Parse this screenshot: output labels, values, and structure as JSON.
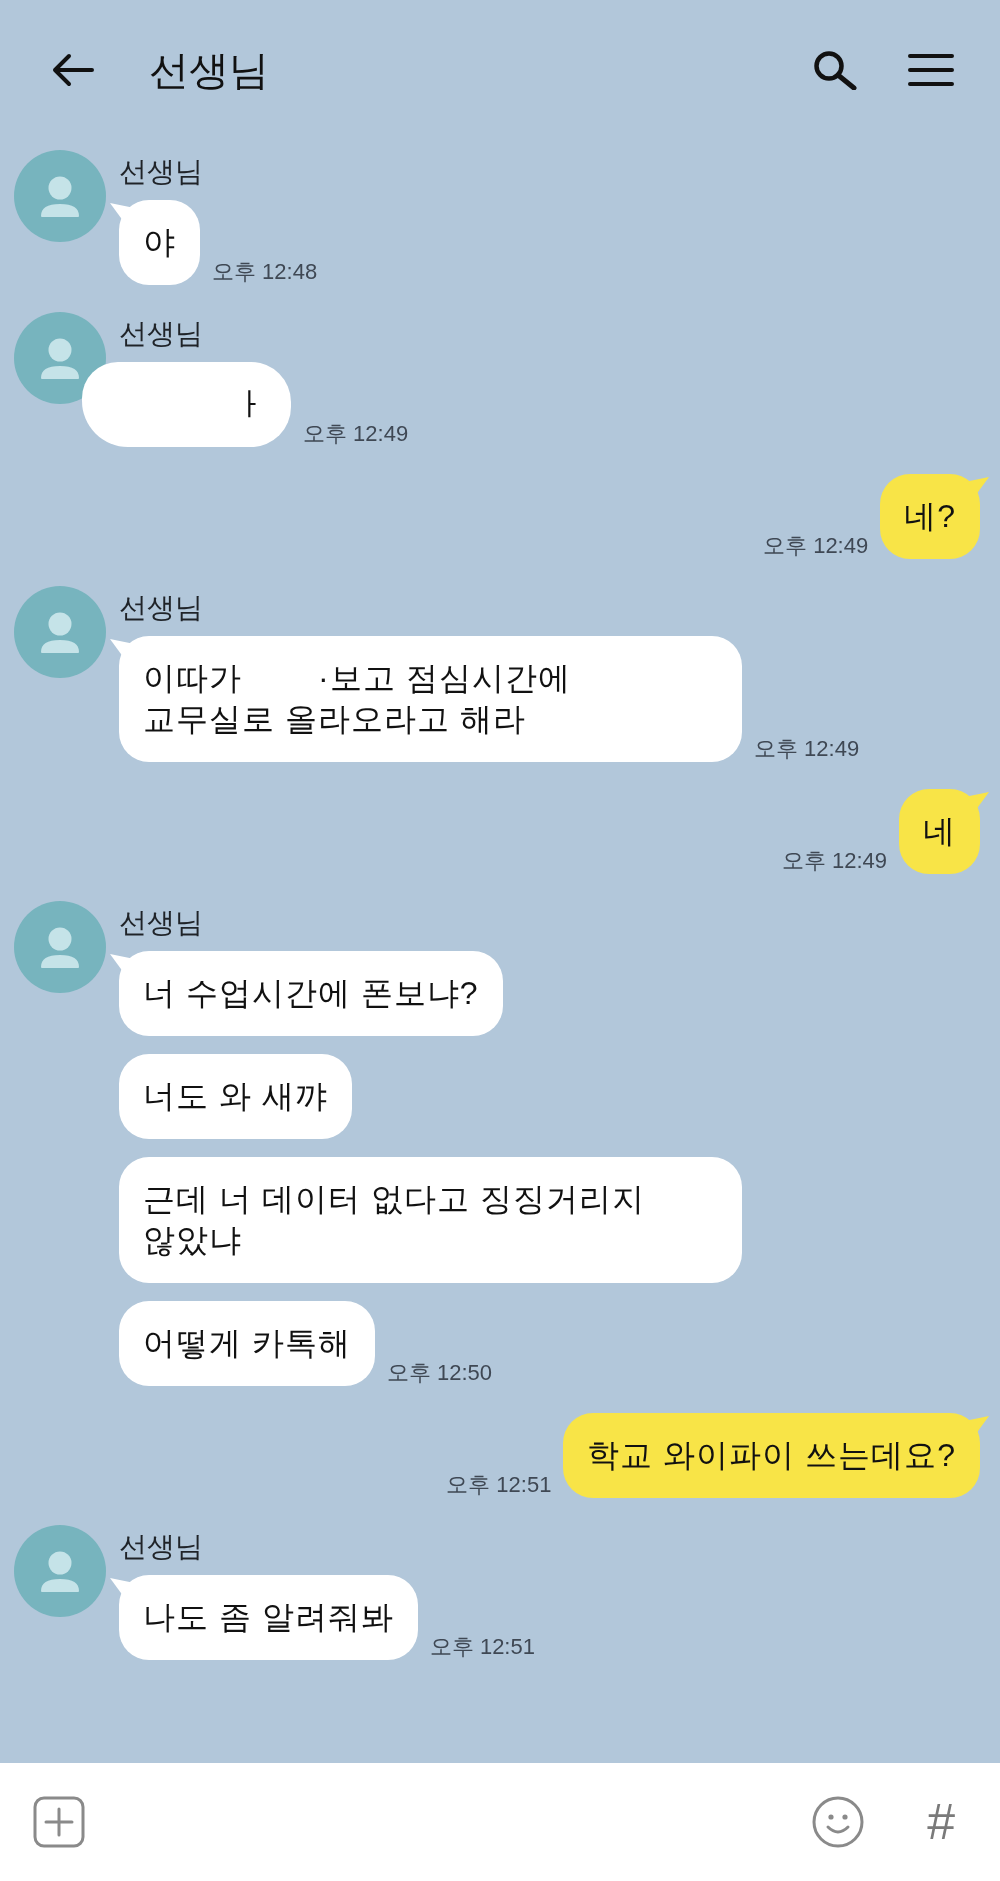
{
  "header": {
    "title": "선생님"
  },
  "messages": [
    {
      "kind": "received",
      "sender": "선생님",
      "bubbles": [
        {
          "text": "야"
        }
      ],
      "time": "오후 12:48"
    },
    {
      "kind": "received",
      "sender": "선생님",
      "bubbles": [
        {
          "lines": [
            [
              {
                "kind": "redaction"
              },
              {
                "kind": "text",
                "text": "ㅏ"
              }
            ]
          ]
        }
      ],
      "time": "오후 12:49"
    },
    {
      "kind": "sent",
      "bubbles": [
        {
          "text": "네?"
        }
      ],
      "time": "오후 12:49"
    },
    {
      "kind": "received",
      "sender": "선생님",
      "bubbles": [
        {
          "lines": [
            [
              {
                "kind": "text",
                "text": "이따가"
              },
              {
                "kind": "redaction"
              },
              {
                "kind": "text",
                "text": "·보고 점심시간에"
              }
            ],
            [
              {
                "kind": "text",
                "text": "교무실로 올라오라고 해라"
              }
            ]
          ]
        }
      ],
      "time": "오후 12:49"
    },
    {
      "kind": "sent",
      "bubbles": [
        {
          "text": "네"
        }
      ],
      "time": "오후 12:49"
    },
    {
      "kind": "received",
      "sender": "선생님",
      "bubbles": [
        {
          "text": "너 수업시간에 폰보냐?"
        },
        {
          "text": "너도 와 새꺄"
        },
        {
          "text": "근데 너 데이터 없다고 징징거리지\n않았냐"
        },
        {
          "text": "어떻게 카톡해"
        }
      ],
      "time": "오후 12:50"
    },
    {
      "kind": "sent",
      "bubbles": [
        {
          "text": "학교 와이파이 쓰는데요?"
        }
      ],
      "time": "오후 12:51"
    },
    {
      "kind": "received",
      "sender": "선생님",
      "bubbles": [
        {
          "text": "나도 좀 알려줘봐"
        }
      ],
      "time": "오후 12:51"
    }
  ],
  "input_bar": {
    "hashtag": "#"
  }
}
